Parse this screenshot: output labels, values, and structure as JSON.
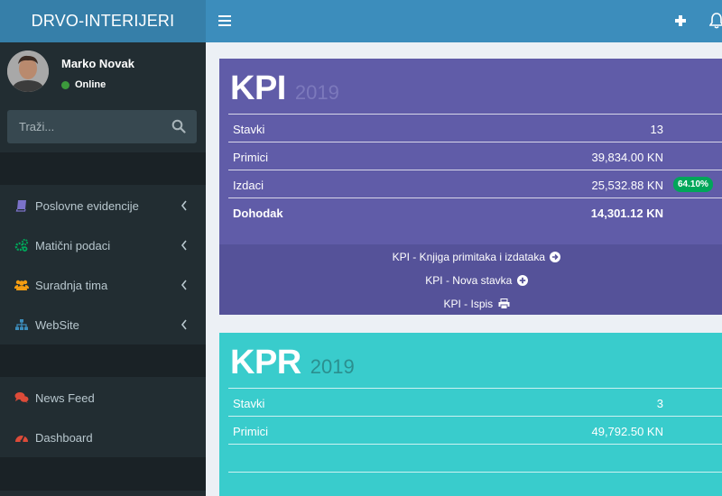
{
  "app": {
    "title": "DRVO-INTERIJERI"
  },
  "colors": {
    "navbar": "#3c8dbc",
    "logo_bg": "#367fa9",
    "sidebar": "#222d32",
    "kpi_box": "#605ca8",
    "kpr_box": "#39cccc",
    "success_badge": "#00a65a"
  },
  "user": {
    "name": "Marko Novak",
    "status": "Online"
  },
  "search": {
    "placeholder": "Traži..."
  },
  "sidebar": {
    "items": [
      {
        "label": "Poslovne evidencije",
        "icon": "book-icon",
        "icon_color": "#7b72c9"
      },
      {
        "label": "Matični podaci",
        "icon": "cogs-icon",
        "icon_color": "#00a65a"
      },
      {
        "label": "Suradnja tima",
        "icon": "users-icon",
        "icon_color": "#f39c12"
      },
      {
        "label": "WebSite",
        "icon": "sitemap-icon",
        "icon_color": "#3c8dbc"
      },
      {
        "label": "News Feed",
        "icon": "comments-icon",
        "icon_color": "#dd4b39"
      },
      {
        "label": "Dashboard",
        "icon": "dashboard-icon",
        "icon_color": "#dd4b39"
      }
    ]
  },
  "kpi": {
    "title": "KPI",
    "year": "2019",
    "rows": [
      {
        "label": "Stavki",
        "value": "13"
      },
      {
        "label": "Primici",
        "value": "39,834.00 KN"
      },
      {
        "label": "Izdaci",
        "value": "25,532.88 KN",
        "badge": "64.10%"
      },
      {
        "label": "Dohodak",
        "value": "14,301.12 KN"
      }
    ],
    "links": [
      {
        "label": "KPI - Knjiga primitaka i izdataka",
        "icon": "arrow-circle-right-icon"
      },
      {
        "label": "KPI - Nova stavka",
        "icon": "plus-circle-icon"
      },
      {
        "label": "KPI - Ispis",
        "icon": "print-icon"
      }
    ]
  },
  "kpr": {
    "title": "KPR",
    "year": "2019",
    "rows": [
      {
        "label": "Stavki",
        "value": "3"
      },
      {
        "label": "Primici",
        "value": "49,792.50 KN"
      }
    ]
  }
}
